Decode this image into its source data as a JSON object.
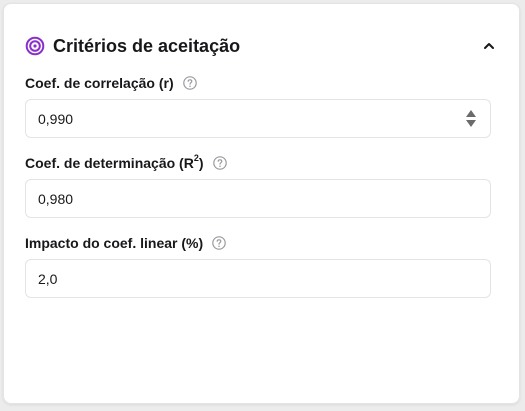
{
  "panel": {
    "title": "Critérios de aceitação",
    "accent_color": "#8b2fc9",
    "icon": "target-icon",
    "collapse_icon": "chevron-up-icon"
  },
  "fields": [
    {
      "label": "Coef. de correlação (r)",
      "value": "0,990",
      "help_icon": "help-circle-icon",
      "has_spinner": true
    },
    {
      "label_prefix": "Coef. de determinação (R",
      "label_sup": "2",
      "label_suffix": ")",
      "value": "0,980",
      "help_icon": "help-circle-icon"
    },
    {
      "label": "Impacto do coef. linear (%)",
      "value": "2,0",
      "help_icon": "help-circle-icon"
    }
  ]
}
